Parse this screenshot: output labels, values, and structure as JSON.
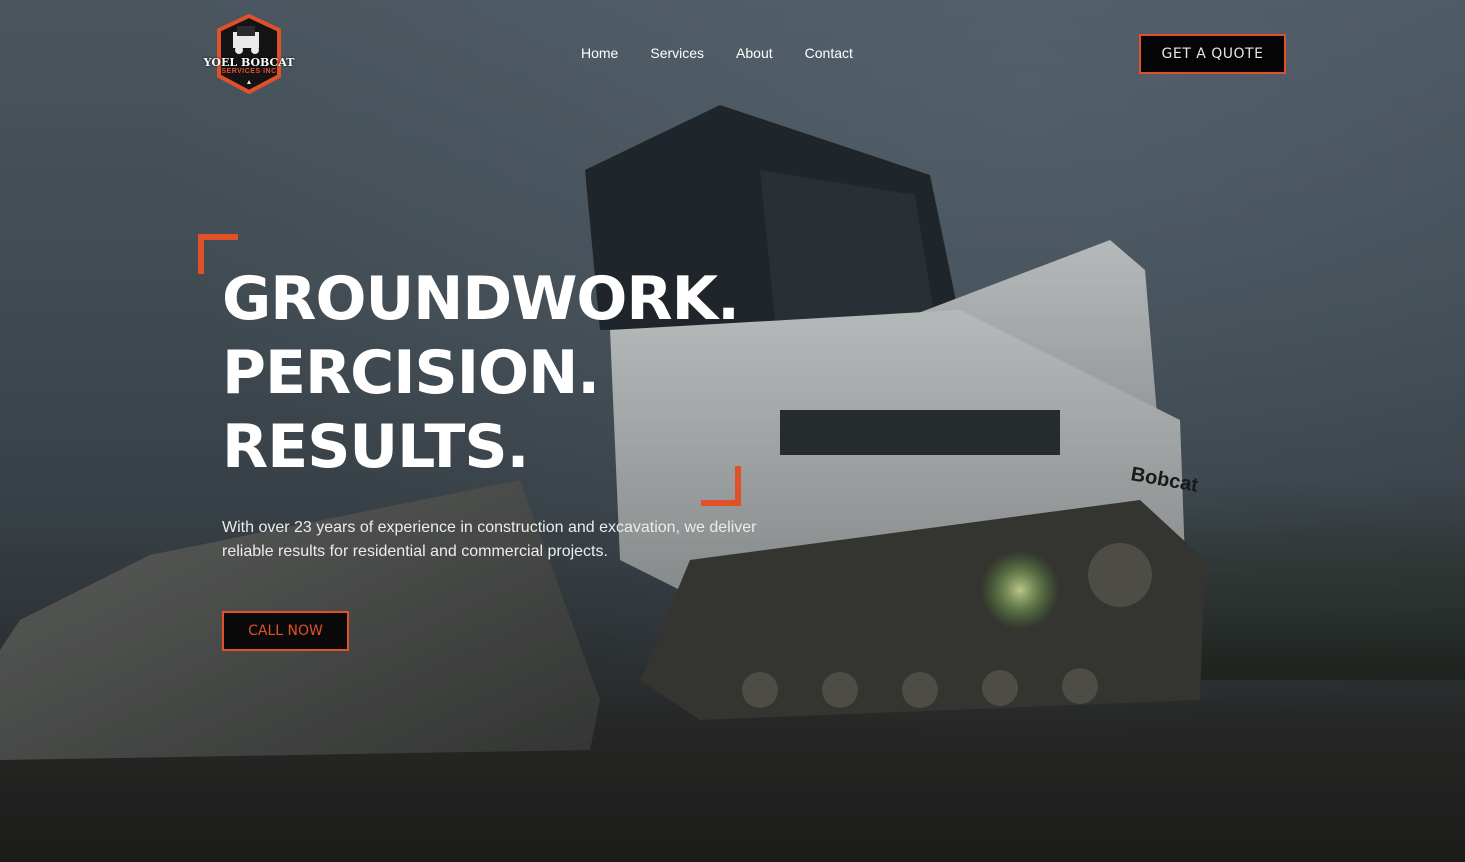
{
  "brand": {
    "logo_title": "YOEL BOBCAT",
    "logo_subtitle": "SERVICES INC",
    "accent_color": "#e0512a"
  },
  "nav": {
    "items": [
      {
        "label": "Home"
      },
      {
        "label": "Services"
      },
      {
        "label": "About"
      },
      {
        "label": "Contact"
      }
    ]
  },
  "header": {
    "cta_label": "GET A QUOTE"
  },
  "hero": {
    "headline_lines": [
      "GROUNDWORK.",
      "PERCISION.",
      "RESULTS."
    ],
    "lead": "With over 23 years of experience in construction and excavation, we deliver reliable results for residential and commercial projects.",
    "cta_label": "CALL NOW",
    "machine_brand": "Bobcat"
  }
}
